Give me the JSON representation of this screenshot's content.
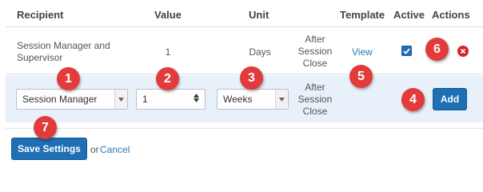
{
  "headers": {
    "recipient": "Recipient",
    "value": "Value",
    "unit": "Unit",
    "template": "Template",
    "active": "Active",
    "actions": "Actions"
  },
  "row1": {
    "recipient_line1": "Session Manager and",
    "recipient_line2": "Supervisor",
    "value": "1",
    "unit": "Days",
    "when_line1": "After",
    "when_line2": "Session",
    "when_line3": "Close",
    "template_link": "View",
    "active_checked": true
  },
  "edit_row": {
    "recipient_select": "Session Manager",
    "value_input": "1",
    "unit_select": "Weeks",
    "when_line1": "After",
    "when_line2": "Session",
    "when_line3": "Close",
    "add_label": "Add"
  },
  "footer": {
    "save_label": "Save Settings",
    "or_text": "or",
    "cancel_label": "Cancel"
  },
  "callouts": {
    "c1": "1",
    "c2": "2",
    "c3": "3",
    "c4": "4",
    "c5": "5",
    "c6": "6",
    "c7": "7"
  },
  "colors": {
    "accent": "#1e6fb3",
    "callout": "#e23b3b",
    "edit_row_bg": "#e8f1f9",
    "delete": "#d9232d"
  }
}
